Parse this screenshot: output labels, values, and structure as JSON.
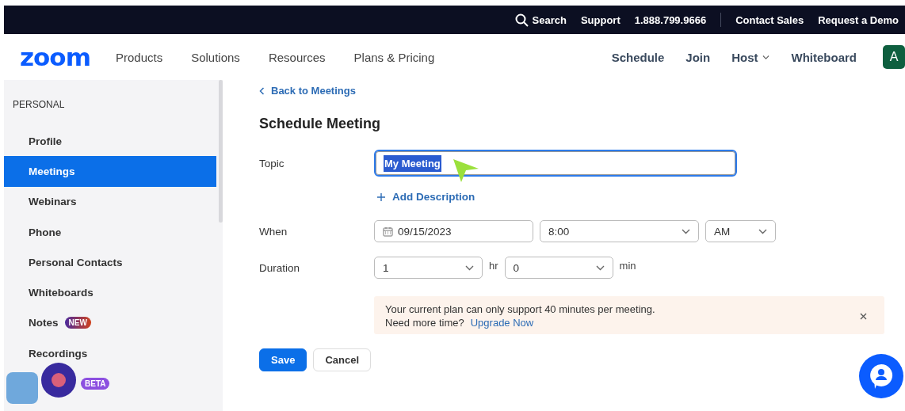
{
  "top_bar": {
    "links": [
      {
        "label": "Search",
        "kind": "search"
      },
      {
        "label": "Support",
        "kind": "link"
      },
      {
        "label": "1.888.799.9666",
        "kind": "phone"
      },
      {
        "label": "Contact Sales",
        "kind": "link"
      },
      {
        "label": "Request a Demo",
        "kind": "link"
      }
    ]
  },
  "nav": {
    "logo": "zoom",
    "menu": [
      "Products",
      "Solutions",
      "Resources",
      "Plans & Pricing"
    ],
    "actions": [
      {
        "label": "Schedule",
        "dropdown": false
      },
      {
        "label": "Join",
        "dropdown": false
      },
      {
        "label": "Host",
        "dropdown": true
      },
      {
        "label": "Whiteboard",
        "dropdown": false
      }
    ],
    "avatar": "A"
  },
  "sidebar": {
    "section": "PERSONAL",
    "items": [
      {
        "label": "Profile",
        "selected": false
      },
      {
        "label": "Meetings",
        "selected": true
      },
      {
        "label": "Webinars",
        "selected": false
      },
      {
        "label": "Phone",
        "selected": false
      },
      {
        "label": "Personal Contacts",
        "selected": false
      },
      {
        "label": "Whiteboards",
        "selected": false
      },
      {
        "label": "Notes",
        "selected": false,
        "badge": "NEW"
      },
      {
        "label": "Recordings",
        "selected": false
      },
      {
        "selected": false,
        "badge": "BETA"
      }
    ]
  },
  "form": {
    "back_link": "Back to Meetings",
    "title": "Schedule Meeting",
    "topic": {
      "label": "Topic",
      "value": "My Meeting",
      "text_selected": true
    },
    "add_description": "Add Description",
    "when": {
      "label": "When",
      "date": "09/15/2023",
      "time": "8:00",
      "period": "AM"
    },
    "duration": {
      "label": "Duration",
      "hours": "1",
      "hours_unit": "hr",
      "minutes": "0",
      "minutes_unit": "min"
    },
    "notice": {
      "message": "Your current plan can only support 40 minutes per meeting.",
      "question": "Need more time?",
      "link": "Upgrade Now"
    },
    "buttons": [
      {
        "label": "Save",
        "kind": "primary"
      },
      {
        "label": "Cancel",
        "kind": "secondary"
      }
    ]
  }
}
